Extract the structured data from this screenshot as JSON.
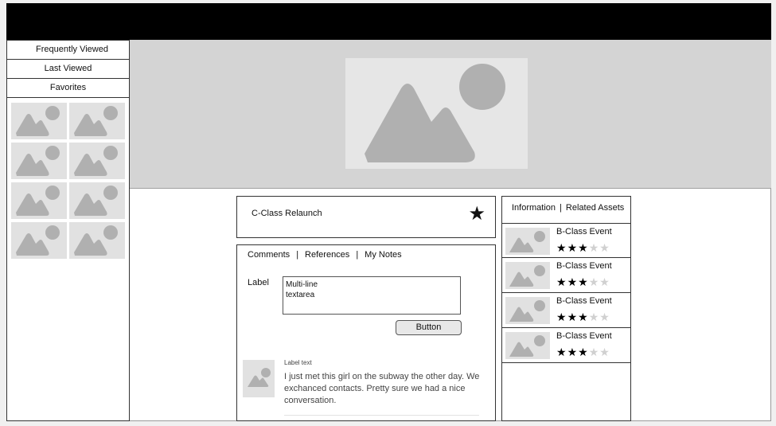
{
  "sidebar": {
    "nav": [
      {
        "label": "Frequently Viewed"
      },
      {
        "label": "Last Viewed"
      },
      {
        "label": "Favorites"
      }
    ],
    "thumbnail_icon": "image-placeholder-icon",
    "thumbnail_count": 8
  },
  "hero": {
    "icon": "image-placeholder-icon"
  },
  "item": {
    "title": "C-Class Relaunch",
    "favorite_icon": "star-icon"
  },
  "content": {
    "tabs": [
      {
        "label": "Comments"
      },
      {
        "label": "References"
      },
      {
        "label": "My Notes"
      }
    ],
    "tab_separator": "|",
    "form": {
      "label": "Label",
      "textarea_value": "Multi-line\ntextarea",
      "button_label": "Button"
    },
    "comment": {
      "label": "Label text",
      "text": "I just met this girl on the subway the other day. We exchanced contacts. Pretty sure we had a nice conversation.",
      "avatar_icon": "image-placeholder-icon"
    }
  },
  "right_panel": {
    "tabs": [
      {
        "label": "Information"
      },
      {
        "label": "Related Assets"
      }
    ],
    "tab_separator": "|",
    "assets": [
      {
        "title": "B-Class Event",
        "rating": 3,
        "max_rating": 5
      },
      {
        "title": "B-Class Event",
        "rating": 3,
        "max_rating": 5
      },
      {
        "title": "B-Class Event",
        "rating": 3,
        "max_rating": 5
      },
      {
        "title": "B-Class Event",
        "rating": 3,
        "max_rating": 5
      }
    ]
  },
  "colors": {
    "topbar": "#000000",
    "hero_background": "#d4d4d4",
    "placeholder": "#b0b0b0"
  }
}
